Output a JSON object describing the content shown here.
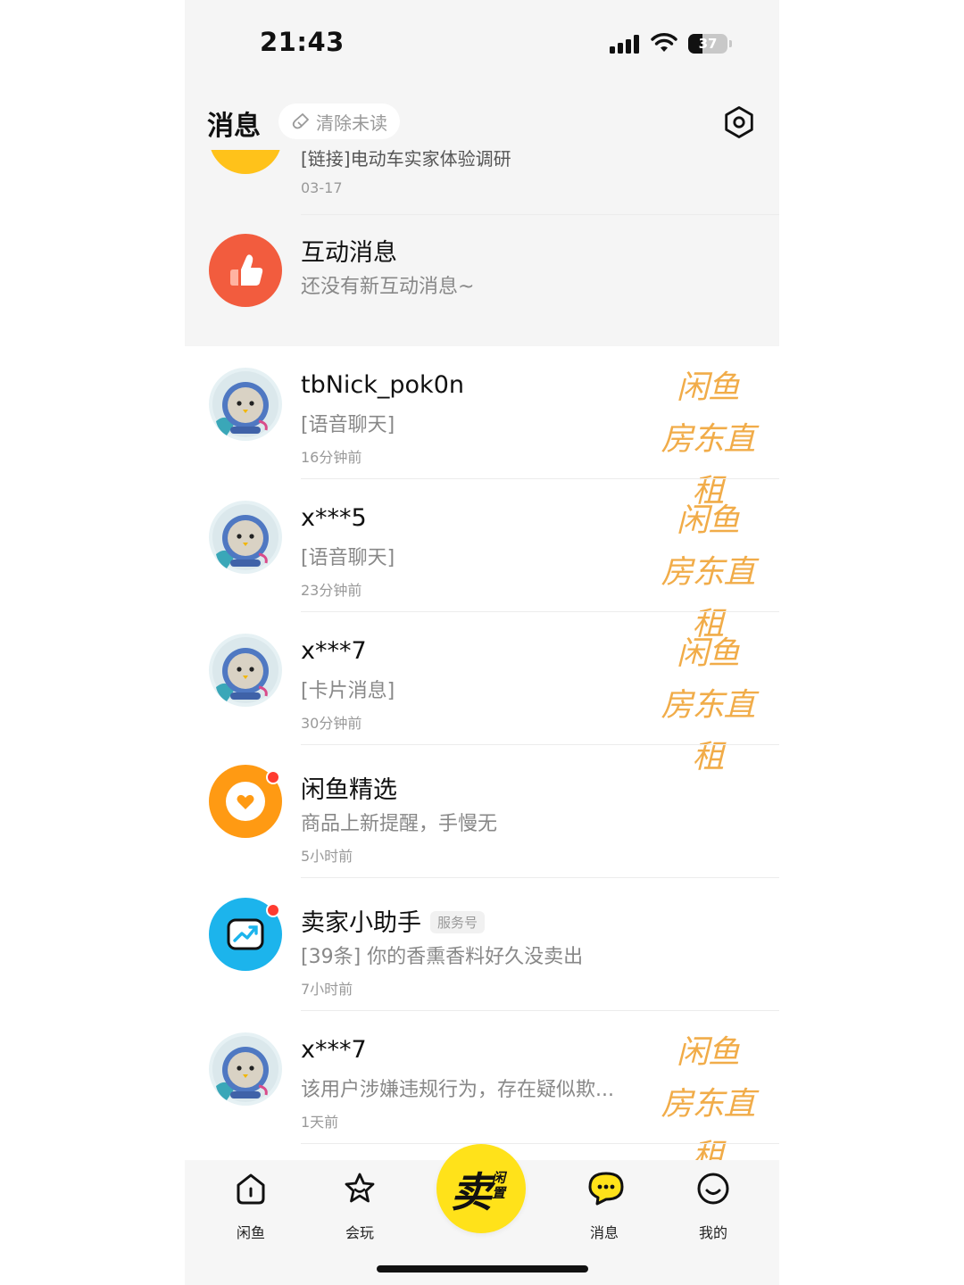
{
  "status_bar": {
    "time": "21:43",
    "battery": "37",
    "battery_level": 0.37
  },
  "header": {
    "title": "消息",
    "clear_unread": "清除未读"
  },
  "top_rows": [
    {
      "title": "[链接]电动车实家体验调研",
      "time": "03-17"
    },
    {
      "title": "互动消息",
      "subtitle": "还没有新互动消息~"
    }
  ],
  "conversations": [
    {
      "name": "tbNick_pok0n",
      "preview": "[语音聊天]",
      "time": "16分钟前",
      "watermark": [
        "闲鱼",
        "房东直租"
      ]
    },
    {
      "name": "x***5",
      "preview": "[语音聊天]",
      "time": "23分钟前",
      "watermark": [
        "闲鱼",
        "房东直租"
      ]
    },
    {
      "name": "x***7",
      "preview": "[卡片消息]",
      "time": "30分钟前",
      "watermark": [
        "闲鱼",
        "房东直租"
      ]
    },
    {
      "name": "闲鱼精选",
      "preview": "商品上新提醒，手慢无",
      "time": "5小时前"
    },
    {
      "name": "卖家小助手",
      "badge": "服务号",
      "preview": "[39条] 你的香熏香料好久没卖出",
      "time": "7小时前"
    },
    {
      "name": "x***7",
      "preview": "该用户涉嫌违规行为，存在疑似欺...",
      "time": "1天前",
      "watermark": [
        "闲鱼",
        "房东直租"
      ]
    }
  ],
  "tabbar": {
    "tabs": [
      {
        "label": "闲鱼",
        "icon": "home-icon"
      },
      {
        "label": "会玩",
        "icon": "star-face-icon"
      },
      {
        "label": "消息",
        "icon": "chat-bubble-icon"
      },
      {
        "label": "我的",
        "icon": "smile-icon"
      }
    ],
    "sell": {
      "main": "卖",
      "sub": "闲置"
    }
  },
  "colors": {
    "accent": "#ffe21a",
    "like_red": "#f25c3e",
    "xianyu_orange": "#ff9a13",
    "assistant_blue": "#1cb4ec",
    "unread": "#ff3b30"
  }
}
